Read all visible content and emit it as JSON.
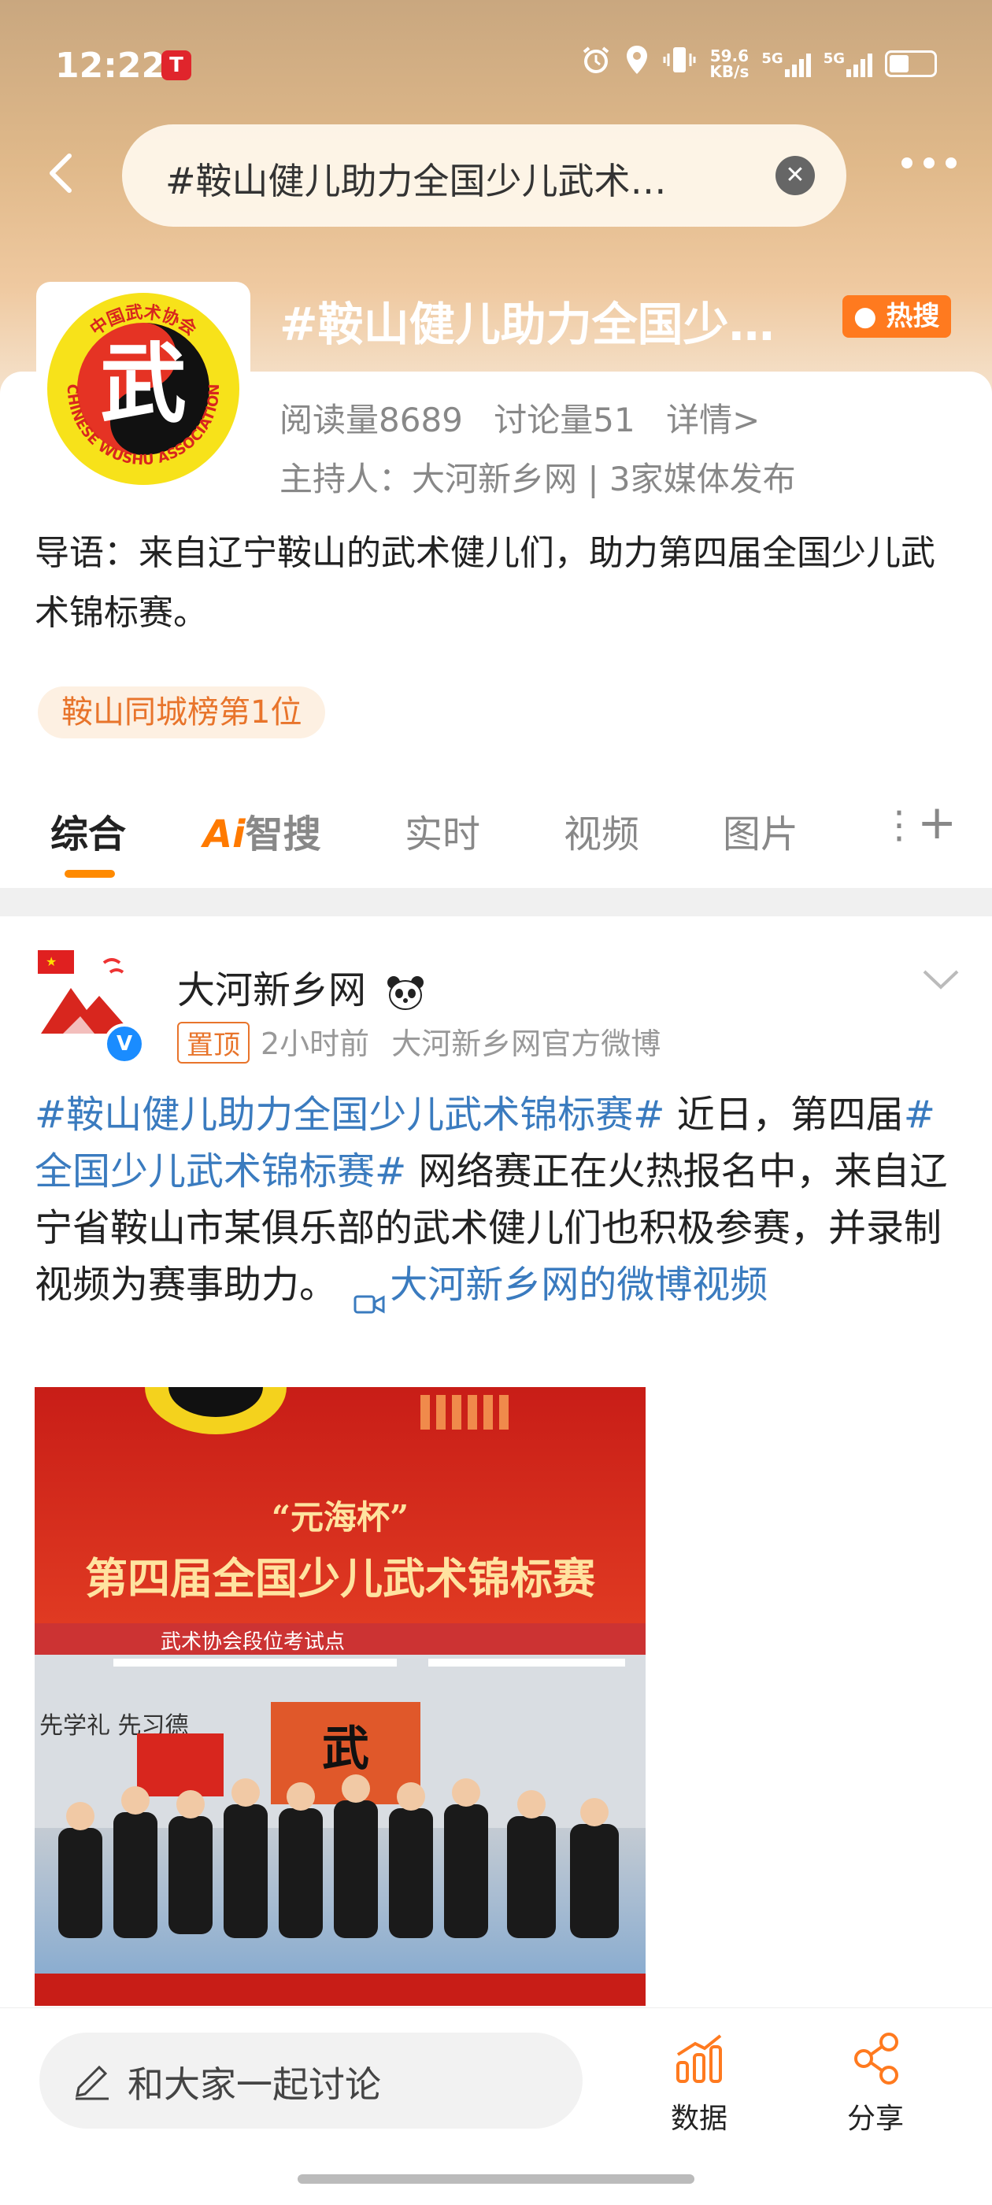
{
  "status_bar": {
    "time": "12:22",
    "net_speed_value": "59.6",
    "net_speed_unit": "KB/s",
    "signal1_label": "5G",
    "signal2_label": "5G"
  },
  "search": {
    "query": "#鞍山健儿助力全国少儿武术…"
  },
  "topic": {
    "title": "#鞍山健儿助力全国少…",
    "hot_badge": "热搜",
    "reads": "阅读量8689",
    "discussions": "讨论量51",
    "details_link": "详情>",
    "host": "主持人：大河新乡网 | 3家媒体发布",
    "intro": "导语：来自辽宁鞍山的武术健儿们，助力第四届全国少儿武术锦标赛。",
    "rank_badge": "鞍山同城榜第1位",
    "logo_char": "武",
    "logo_text_top": "中国武术协会",
    "logo_text_bottom": "CHINESE WUSHU ASSOCIATION"
  },
  "tabs": {
    "items": [
      "综合",
      "智搜",
      "实时",
      "视频",
      "图片"
    ],
    "ai_prefix": "Ai",
    "more": "⋮",
    "add": "+"
  },
  "post": {
    "author": "大河新乡网",
    "pinned": "置顶",
    "time": "2小时前",
    "source": "大河新乡网官方微博",
    "tag1": "#鞍山健儿助力全国少儿武术锦标赛#",
    "text1": " 近日，第四届",
    "tag2": "#全国少儿武术锦标赛#",
    "text2": " 网络赛正在火热报名中，来自辽宁省鞍山市某俱乐部的武术健儿们也积极参赛，并录制视频为赛事助力。 ",
    "video_link": "大河新乡网的微博视频",
    "image": {
      "cup_title": "“元海杯”",
      "event_title": "第四届全国少儿武术锦标赛",
      "banner_text": "武术协会段位考试点",
      "wall_text_left": "先学礼 先习德"
    }
  },
  "bottom_bar": {
    "discuss_placeholder": "和大家一起讨论",
    "data_label": "数据",
    "share_label": "分享"
  },
  "colors": {
    "accent_orange": "#ff7a1f",
    "link_blue": "#3a7bbf",
    "verified_blue": "#1a8cff",
    "poster_red": "#d8261e"
  }
}
